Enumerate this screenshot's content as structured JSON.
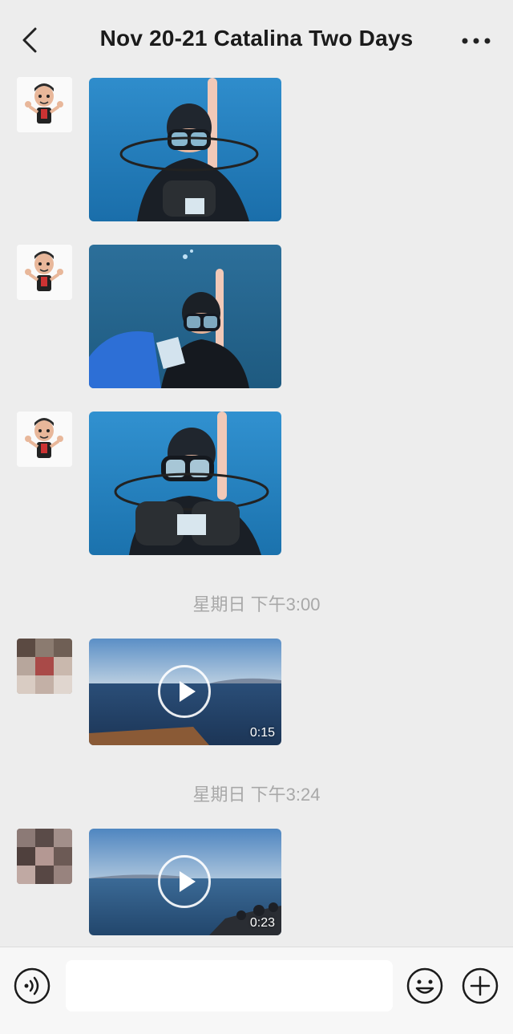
{
  "header": {
    "title": "Nov 20-21 Catalina Two Days",
    "back_icon": "chevron-left-icon",
    "more_icon": "ellipsis-icon"
  },
  "messages": [
    {
      "type": "image",
      "sender": "cartoon-avatar",
      "content": "diver-photo"
    },
    {
      "type": "image",
      "sender": "cartoon-avatar",
      "content": "diver-photo"
    },
    {
      "type": "image",
      "sender": "cartoon-avatar",
      "content": "diver-photo"
    },
    {
      "type": "timestamp",
      "text": "星期日 下午3:00"
    },
    {
      "type": "video",
      "sender": "blurred-avatar",
      "duration": "0:15"
    },
    {
      "type": "timestamp",
      "text": "星期日 下午3:24"
    },
    {
      "type": "video",
      "sender": "blurred-avatar",
      "duration": "0:23"
    }
  ],
  "input_bar": {
    "voice_icon": "voice-icon",
    "emoji_icon": "emoji-icon",
    "plus_icon": "plus-icon",
    "placeholder": ""
  },
  "colors": {
    "background": "#ededed",
    "title": "#1b1b1b",
    "timestamp": "#a8a8a8",
    "input_bar": "#f7f7f7"
  }
}
